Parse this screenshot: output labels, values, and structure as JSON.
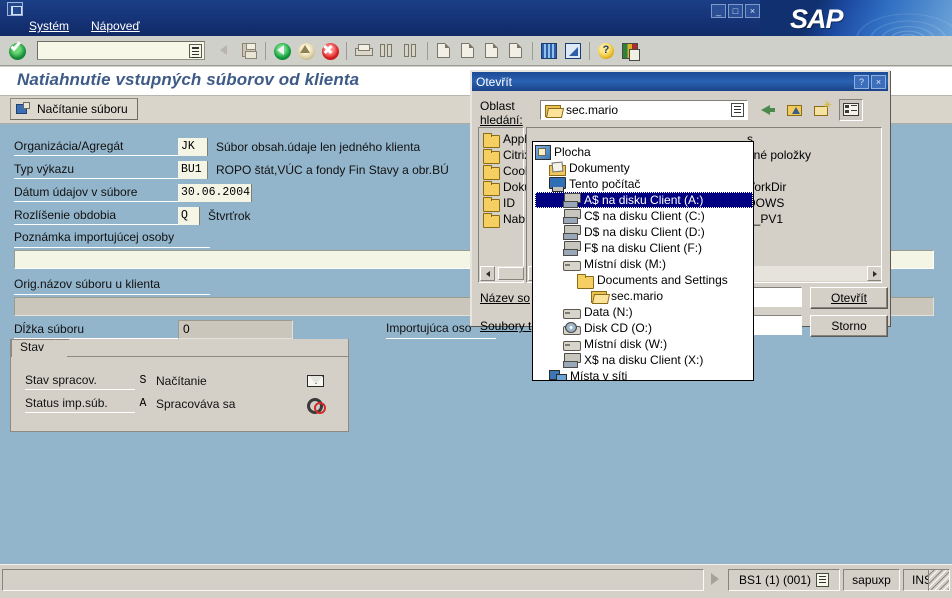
{
  "window": {
    "menus": [
      "Systém",
      "Nápoveď"
    ],
    "min_label": "_",
    "max_label": "□",
    "close_label": "×",
    "brand": "SAP"
  },
  "toolbar": {
    "command_value": "",
    "icons": [
      "ok-check-icon",
      "save-icon",
      "back-icon",
      "exit-up-icon",
      "cancel-icon",
      "print-icon",
      "find-icon",
      "find-next-icon",
      "first-page-icon",
      "previous-page-icon",
      "next-page-icon",
      "last-page-icon",
      "create-session-icon",
      "create-shortcut-icon",
      "help-icon",
      "layout-menu-icon"
    ]
  },
  "app": {
    "title": "Natiahnutie vstupných súborov od klienta",
    "action_button": "Načítanie súboru"
  },
  "form": {
    "rows": [
      {
        "label": "Organizácia/Agregát",
        "value": "JK",
        "text": "Súbor obsah.údaje len jedného klienta"
      },
      {
        "label": "Typ výkazu",
        "value": "BU1",
        "text": "ROPO štát,VÚC a fondy Fin Stavy a obr.BÚ"
      },
      {
        "label": "Dátum údajov v súbore",
        "value": "30.06.2004",
        "text": ""
      },
      {
        "label": "Rozlíšenie obdobia",
        "value": "Q",
        "text": "Štvrťrok"
      }
    ],
    "note_label": "Poznámka importujúcej osoby",
    "note_value": "",
    "origname_label": "Orig.názov súboru u klienta",
    "origname_value": "",
    "length_label": "Dĺžka súboru",
    "length_value": "0",
    "importer_label": "Importujúca oso"
  },
  "status_group": {
    "title": "Stav",
    "rows": [
      {
        "label": "Stav spracov.",
        "code": "S",
        "text": "Načítanie",
        "icon": "mail-icon"
      },
      {
        "label": "Status imp.súb.",
        "code": "A",
        "text": "Spracováva sa",
        "icon": "gears-icon"
      }
    ]
  },
  "statusbar": {
    "system": "BS1 (1) (001)",
    "server": "sapuxp",
    "mode": "INS"
  },
  "dialog": {
    "title": "Otevřít",
    "help_btn": "?",
    "close_btn": "×",
    "lookin_label_line1": "Oblast",
    "lookin_label_line2": "hledání:",
    "lookin_value": "sec.mario",
    "nav_icons": [
      "back-arrow-icon",
      "up-one-level-icon",
      "new-folder-icon",
      "views-icon"
    ],
    "places": [
      {
        "label": "Applic",
        "icon": "folder-icon"
      },
      {
        "label": "Citrix",
        "icon": "folder-icon"
      },
      {
        "label": "Cookie",
        "icon": "folder-icon"
      },
      {
        "label": "Dokum",
        "icon": "folder-icon"
      },
      {
        "label": "ID",
        "icon": "folder-icon"
      },
      {
        "label": "Nabídl",
        "icon": "folder-icon"
      }
    ],
    "file_column_2": [
      "s",
      "ené položky",
      "a",
      "VorkDir",
      "DOWS",
      "5_PV1"
    ],
    "filename_label": "Název so",
    "filename_value": "",
    "filetype_label": "Soubory t",
    "filetype_value": "",
    "open_button": "Otevřít",
    "cancel_button": "Storno",
    "tree": [
      {
        "label": "Plocha",
        "icon": "desktop-icon",
        "indent": 1,
        "selected": false
      },
      {
        "label": "Dokumenty",
        "icon": "documents-icon",
        "indent": 2,
        "selected": false
      },
      {
        "label": "Tento počítač",
        "icon": "computer-icon",
        "indent": 2,
        "selected": false
      },
      {
        "label": "A$ na disku Client (A:)",
        "icon": "net-drive-icon",
        "indent": 3,
        "selected": true
      },
      {
        "label": "C$ na disku Client (C:)",
        "icon": "net-drive-icon",
        "indent": 3,
        "selected": false
      },
      {
        "label": "D$ na disku Client (D:)",
        "icon": "net-drive-icon",
        "indent": 3,
        "selected": false
      },
      {
        "label": "F$ na disku Client (F:)",
        "icon": "net-drive-icon",
        "indent": 3,
        "selected": false
      },
      {
        "label": "Místní disk (M:)",
        "icon": "drive-icon",
        "indent": 3,
        "selected": false
      },
      {
        "label": "Documents and Settings",
        "icon": "folder-icon",
        "indent": 4,
        "selected": false
      },
      {
        "label": "sec.mario",
        "icon": "folder-open-icon",
        "indent": 5,
        "selected": false
      },
      {
        "label": "Data (N:)",
        "icon": "drive-icon",
        "indent": 3,
        "selected": false
      },
      {
        "label": "Disk CD (O:)",
        "icon": "cdrom-icon",
        "indent": 3,
        "selected": false
      },
      {
        "label": "Místní disk (W:)",
        "icon": "drive-icon",
        "indent": 3,
        "selected": false
      },
      {
        "label": "X$ na disku Client (X:)",
        "icon": "net-drive-icon",
        "indent": 3,
        "selected": false
      },
      {
        "label": "Místa v síti",
        "icon": "network-icon",
        "indent": 2,
        "selected": false
      }
    ]
  },
  "colors": {
    "canvas": "#93b5cb",
    "field": "#f5f5e6",
    "chrome": "#d4d0c8",
    "title_blue": "#1b3f86",
    "accent": "#3e5a87",
    "selection": "#000080"
  }
}
